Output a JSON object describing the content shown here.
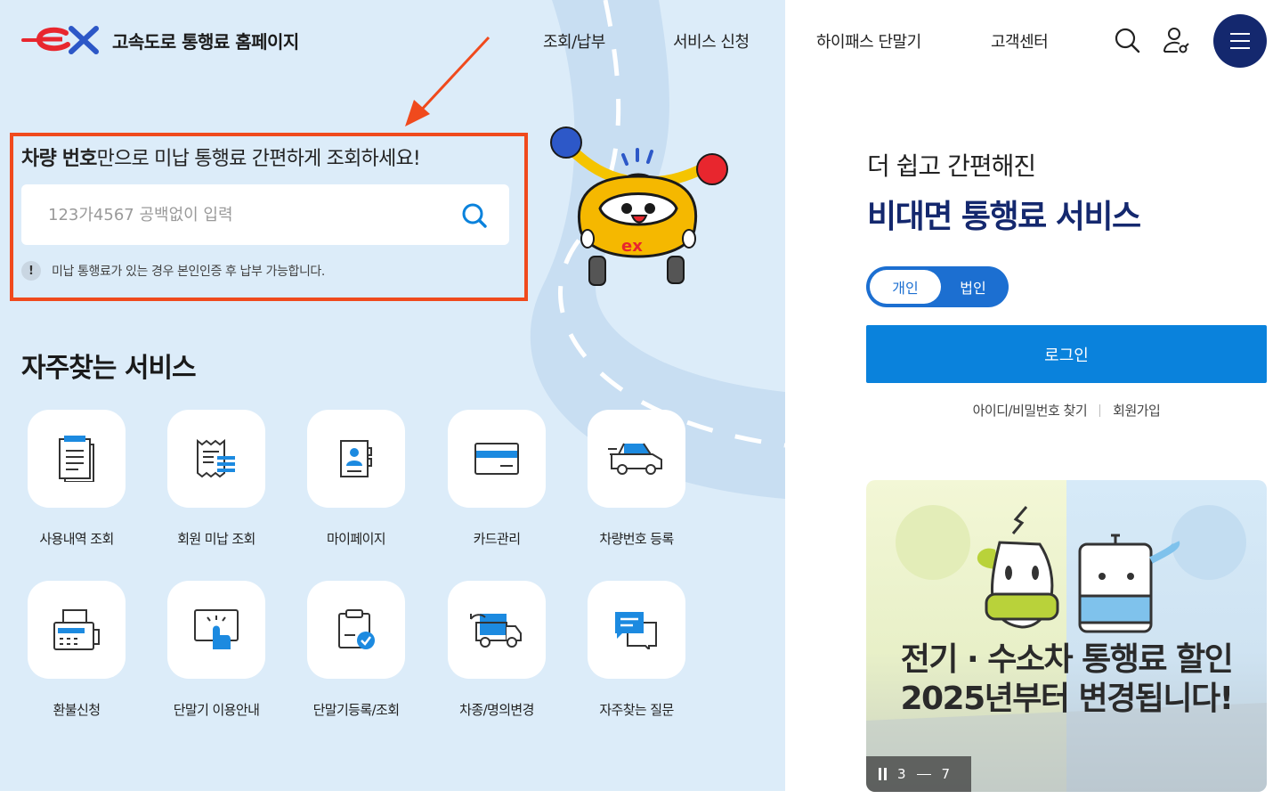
{
  "header": {
    "logo_text": "고속도로 통행료 홈페이지",
    "nav": [
      "조회/납부",
      "서비스 신청",
      "하이패스 단말기",
      "고객센터"
    ],
    "icons": [
      "search-icon",
      "user-icon",
      "menu-icon"
    ]
  },
  "search": {
    "title_bold": "차량 번호",
    "title_rest": "만으로 미납 통행료 간편하게 조회하세요!",
    "placeholder": "123가4567 공백없이 입력",
    "notice_mark": "!",
    "notice": "미납 통행료가 있는 경우 본인인증 후 납부 가능합니다."
  },
  "services": {
    "title": "자주찾는 서비스",
    "items": [
      {
        "label": "사용내역 조회",
        "icon": "document-list-icon"
      },
      {
        "label": "회원 미납 조회",
        "icon": "receipt-icon"
      },
      {
        "label": "마이페이지",
        "icon": "profile-book-icon"
      },
      {
        "label": "카드관리",
        "icon": "credit-card-icon"
      },
      {
        "label": "차량번호 등록",
        "icon": "car-icon"
      },
      {
        "label": "환불신청",
        "icon": "fax-icon"
      },
      {
        "label": "단말기 이용안내",
        "icon": "touch-screen-icon"
      },
      {
        "label": "단말기등록/조회",
        "icon": "clipboard-check-icon"
      },
      {
        "label": "차종/명의변경",
        "icon": "truck-swap-icon"
      },
      {
        "label": "자주찾는 질문",
        "icon": "chat-bubble-icon"
      }
    ]
  },
  "login_panel": {
    "subtitle": "더 쉽고 간편해진",
    "title": "비대면 통행료 서비스",
    "toggle_personal": "개인",
    "toggle_business": "법인",
    "login_button": "로그인",
    "find_id_pw": "아이디/비밀번호 찾기",
    "signup": "회원가입"
  },
  "banner": {
    "line1": "전기 · 수소차 통행료 할인",
    "line2": "2025년부터 변경됩니다!",
    "current": "3",
    "total": "7"
  },
  "colors": {
    "brand_navy": "#14286e",
    "brand_blue": "#0a82dc",
    "highlight_orange": "#f04a1d",
    "hero_bg": "#dcecf9"
  }
}
